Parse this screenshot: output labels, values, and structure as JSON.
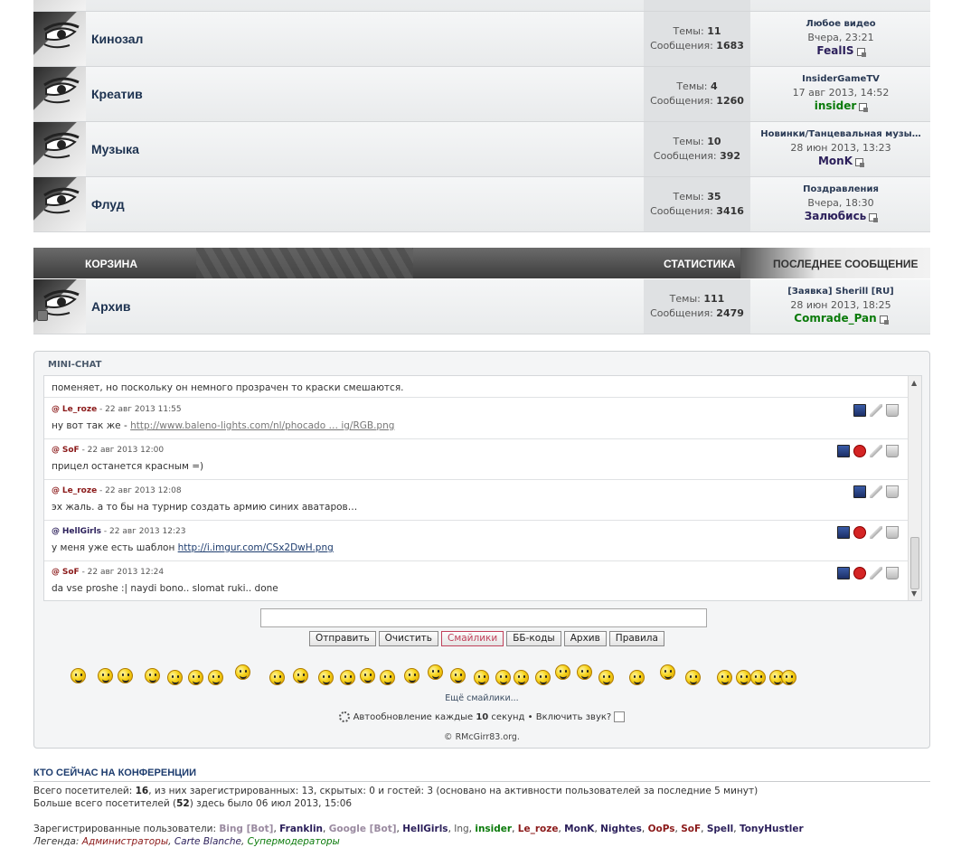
{
  "forums": [
    {
      "title": "Кинозал",
      "topics_label": "Темы:",
      "topics": "11",
      "posts_label": "Сообщения:",
      "posts": "1683",
      "last_title": "Любое видео",
      "last_time": "Вчера, 23:21",
      "last_user": "FealIS",
      "user_color": "#2b1f5a"
    },
    {
      "title": "Креатив",
      "topics_label": "Темы:",
      "topics": "4",
      "posts_label": "Сообщения:",
      "posts": "1260",
      "last_title": "InsiderGameTV",
      "last_time": "17 авг 2013, 14:52",
      "last_user": "insider",
      "user_color": "#0a7a0a"
    },
    {
      "title": "Музыка",
      "topics_label": "Темы:",
      "topics": "10",
      "posts_label": "Сообщения:",
      "posts": "392",
      "last_title": "Новинки/Танцевальная музы…",
      "last_time": "28 июн 2013, 13:23",
      "last_user": "MonK",
      "user_color": "#2b1f5a"
    },
    {
      "title": "Флуд",
      "topics_label": "Темы:",
      "topics": "35",
      "posts_label": "Сообщения:",
      "posts": "3416",
      "last_title": "Поздравления",
      "last_time": "Вчера, 18:30",
      "last_user": "Залюбись",
      "user_color": "#2b1f5a"
    }
  ],
  "category": {
    "title": "КОРЗИНА",
    "stats": "СТАТИСТИКА",
    "last": "ПОСЛЕДНЕЕ СООБЩЕНИЕ"
  },
  "archive": {
    "title": "Архив",
    "topics_label": "Темы:",
    "topics": "111",
    "posts_label": "Сообщения:",
    "posts": "2479",
    "last_title": "[Заявка] Sherill [RU]",
    "last_time": "28 июн 2013, 18:25",
    "last_user": "Comrade_Pan",
    "user_color": "#0a7a0a"
  },
  "minichat": {
    "title": "MINI-CHAT",
    "partial_text": "поменяет, но поскольку он немного прозрачен то краски смешаются.",
    "messages": [
      {
        "prefix": "@",
        "user": "Le_roze",
        "user_color": "#8b1a1a",
        "date": " - 22 авг 2013 11:55",
        "text": "ну вот так же - ",
        "link": "http://www.baleno-lights.com/nl/phocado … ig/RGB.png",
        "link_class": "lk",
        "delete": false
      },
      {
        "prefix": "@",
        "user": "SoF",
        "user_color": "#8b1a1a",
        "date": " - 22 авг 2013 12:00",
        "text": "прицел останется красным =)",
        "link": "",
        "link_class": "lk",
        "delete": true
      },
      {
        "prefix": "@",
        "user": "Le_roze",
        "user_color": "#8b1a1a",
        "date": " - 22 авг 2013 12:08",
        "text": "эх жаль. а то бы на турнир создать армию синих аватаров…",
        "link": "",
        "link_class": "lk",
        "delete": false
      },
      {
        "prefix": "@",
        "user": "HellGirls",
        "user_color": "#2b1f5a",
        "date": " - 22 авг 2013 12:23",
        "text": "у меня уже есть шаблон ",
        "link": "http://i.imgur.com/CSx2DwH.png",
        "link_class": "lk2",
        "delete": true
      },
      {
        "prefix": "@",
        "user": "SoF",
        "user_color": "#8b1a1a",
        "date": " - 22 авг 2013 12:24",
        "text": "da vse proshe :| naydi bono.. slomat ruki.. done",
        "link": "",
        "link_class": "lk",
        "delete": true
      }
    ],
    "input_value": "",
    "buttons": [
      "Отправить",
      "Очистить",
      "Смайлики",
      "ББ-коды",
      "Архив",
      "Правила"
    ],
    "more_smilies": "Ещё смайлики...",
    "auto_prefix": "Автообновление каждые ",
    "auto_seconds": "10",
    "auto_suffix": " секунд • Включить звук?",
    "copyright": "© RMcGirr83.org."
  },
  "who": {
    "title": "КТО СЕЙЧАС НА КОНФЕРЕНЦИИ",
    "line1_a": "Всего посетителей: ",
    "line1_count": "16",
    "line1_b": ", из них зарегистрированных: 13, скрытых: 0 и гостей: 3 (основано на активности пользователей за последние 5 минут)",
    "line2_a": "Больше всего посетителей (",
    "line2_count": "52",
    "line2_b": ") здесь было 06 июл 2013, 15:06",
    "reg_label": "Зарегистрированные пользователи: ",
    "users": [
      {
        "name": "Bing [Bot]",
        "color": "#9a8aa0"
      },
      {
        "name": "Franklin",
        "color": "#2b1f5a"
      },
      {
        "name": "Google [Bot]",
        "color": "#9a8aa0"
      },
      {
        "name": "HellGirls",
        "color": "#2b1f5a"
      },
      {
        "name": "Ing",
        "color": "#555555",
        "plain": true
      },
      {
        "name": "insider",
        "color": "#0a7a0a"
      },
      {
        "name": "Le_roze",
        "color": "#8b1a1a"
      },
      {
        "name": "MonK",
        "color": "#2b1f5a"
      },
      {
        "name": "Nightes",
        "color": "#2b1f5a"
      },
      {
        "name": "OoPs",
        "color": "#8b1a1a"
      },
      {
        "name": "SoF",
        "color": "#8b1a1a"
      },
      {
        "name": "Spell",
        "color": "#2b1f5a"
      },
      {
        "name": "TonyHustler",
        "color": "#2b1f5a"
      }
    ],
    "legend_label": "Легенда: ",
    "legend": [
      {
        "name": "Администраторы",
        "color": "#8b1a1a"
      },
      {
        "name": "Carte Blanche",
        "color": "#2b1f5a"
      },
      {
        "name": "Супермодераторы",
        "color": "#0a7a0a"
      }
    ]
  }
}
